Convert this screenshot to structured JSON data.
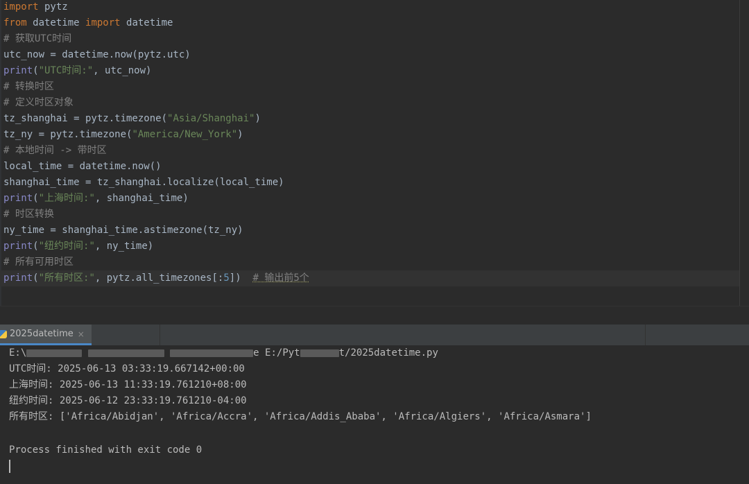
{
  "editor": {
    "lines": [
      [
        {
          "t": "import",
          "c": "kw"
        },
        {
          "t": " pytz",
          "c": "plain"
        }
      ],
      [
        {
          "t": "from",
          "c": "kw"
        },
        {
          "t": " datetime ",
          "c": "plain"
        },
        {
          "t": "import",
          "c": "kw"
        },
        {
          "t": " datetime",
          "c": "plain"
        }
      ],
      [
        {
          "t": "# 获取UTC时间",
          "c": "cm"
        }
      ],
      [
        {
          "t": "utc_now = datetime.now(pytz.utc)",
          "c": "plain"
        }
      ],
      [
        {
          "t": "print",
          "c": "fn"
        },
        {
          "t": "(",
          "c": "plain"
        },
        {
          "t": "\"UTC时间:\"",
          "c": "str"
        },
        {
          "t": ", utc_now)",
          "c": "plain"
        }
      ],
      [
        {
          "t": "# 转换时区",
          "c": "cm"
        }
      ],
      [
        {
          "t": "# 定义时区对象",
          "c": "cm"
        }
      ],
      [
        {
          "t": "tz_shanghai = pytz.timezone(",
          "c": "plain"
        },
        {
          "t": "\"Asia/Shanghai\"",
          "c": "str"
        },
        {
          "t": ")",
          "c": "plain"
        }
      ],
      [
        {
          "t": "tz_ny = pytz.timezone(",
          "c": "plain"
        },
        {
          "t": "\"America/New_York\"",
          "c": "str"
        },
        {
          "t": ")",
          "c": "plain"
        }
      ],
      [
        {
          "t": "# 本地时间 -> 带时区",
          "c": "cm"
        }
      ],
      [
        {
          "t": "local_time = datetime.now()",
          "c": "plain"
        }
      ],
      [
        {
          "t": "shanghai_time = tz_shanghai.localize(local_time)",
          "c": "plain"
        }
      ],
      [
        {
          "t": "print",
          "c": "fn"
        },
        {
          "t": "(",
          "c": "plain"
        },
        {
          "t": "\"上海时间:\"",
          "c": "str"
        },
        {
          "t": ", shanghai_time)",
          "c": "plain"
        }
      ],
      [
        {
          "t": "# 时区转换",
          "c": "cm"
        }
      ],
      [
        {
          "t": "ny_time = shanghai_time.astimezone(tz_ny)",
          "c": "plain"
        }
      ],
      [
        {
          "t": "print",
          "c": "fn"
        },
        {
          "t": "(",
          "c": "plain"
        },
        {
          "t": "\"纽约时间:\"",
          "c": "str"
        },
        {
          "t": ", ny_time)",
          "c": "plain"
        }
      ],
      [
        {
          "t": "# 所有可用时区",
          "c": "cm"
        }
      ],
      [
        {
          "t": "print",
          "c": "fn"
        },
        {
          "t": "(",
          "c": "plain"
        },
        {
          "t": "\"所有时区:\"",
          "c": "str"
        },
        {
          "t": ", pytz.all_timezones[:",
          "c": "plain"
        },
        {
          "t": "5",
          "c": "num"
        },
        {
          "t": "])  ",
          "c": "plain"
        },
        {
          "t": "# 输出前5个",
          "c": "todo"
        }
      ]
    ]
  },
  "run_panel": {
    "tab_label": "2025datetime",
    "close_glyph": "×",
    "command_prefix": "E:\\",
    "command_mid": "e E:/Pyt",
    "command_suffix": "t/2025datetime.py",
    "output": [
      "UTC时间: 2025-06-13 03:33:19.667142+00:00",
      "上海时间: 2025-06-13 11:33:19.761210+08:00",
      "纽约时间: 2025-06-12 23:33:19.761210-04:00",
      "所有时区: ['Africa/Abidjan', 'Africa/Accra', 'Africa/Addis_Ababa', 'Africa/Algiers', 'Africa/Asmara']"
    ],
    "exit_message": "Process finished with exit code 0"
  },
  "colors": {
    "keyword": "#cc7832",
    "comment": "#808080",
    "string": "#6a8759",
    "builtin": "#8888c6",
    "number": "#6897bb",
    "tab_accent": "#4a88c7"
  },
  "icons": {
    "run_tab": "python-file-icon"
  }
}
